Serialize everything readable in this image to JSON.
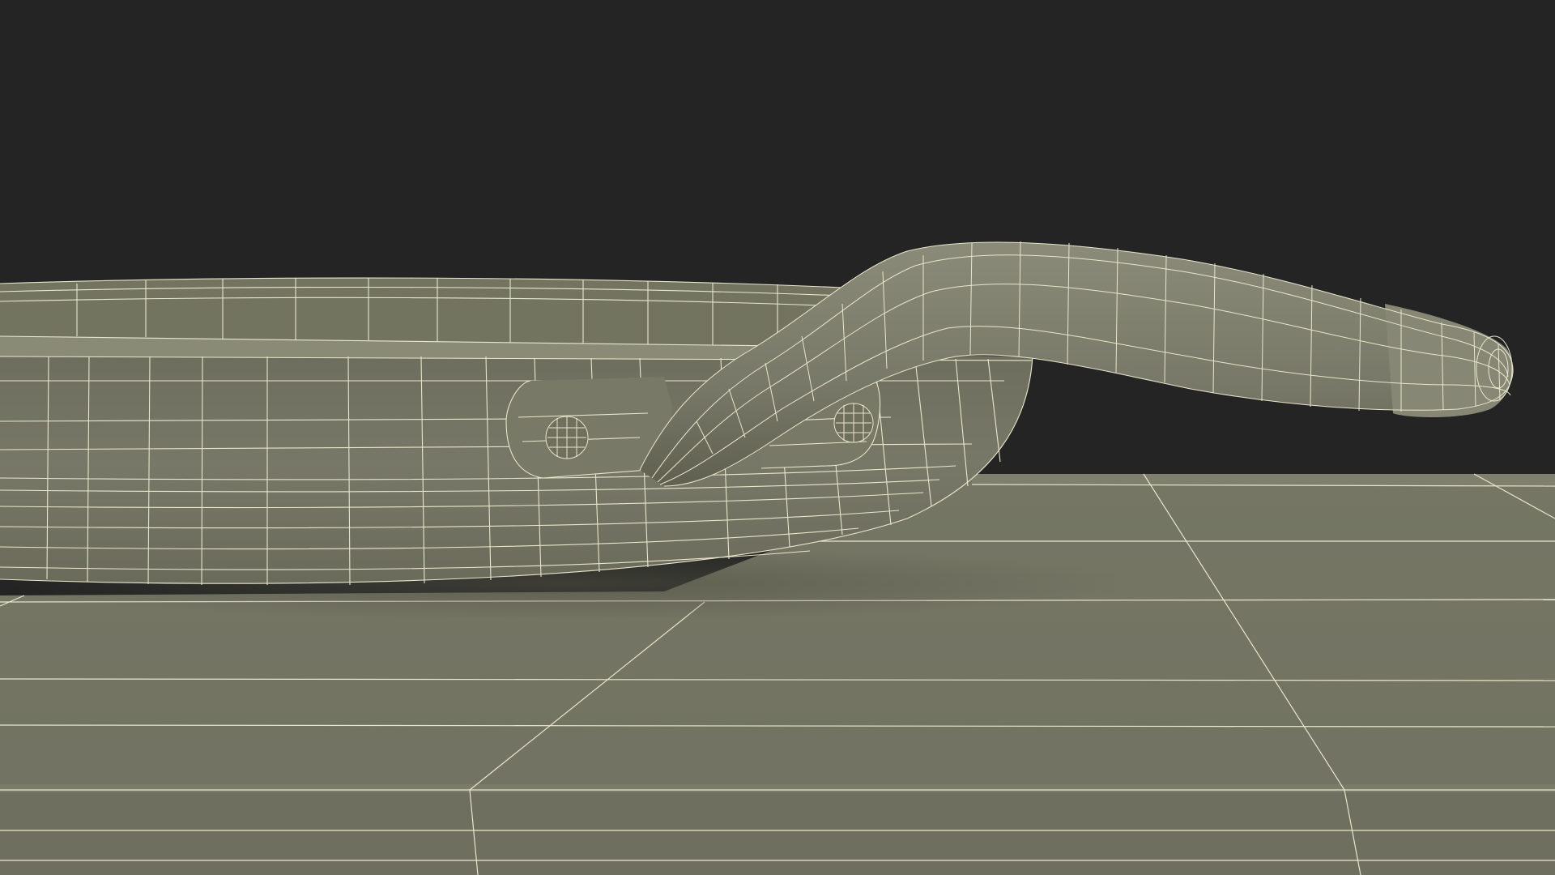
{
  "scene": {
    "subject": "frying-pan-wireframe",
    "colors": {
      "background": "#242424",
      "surface": "#777867",
      "surface_dark": "#676857",
      "surface_light": "#8a8b78",
      "wireframe": "#e9e6cc"
    }
  }
}
